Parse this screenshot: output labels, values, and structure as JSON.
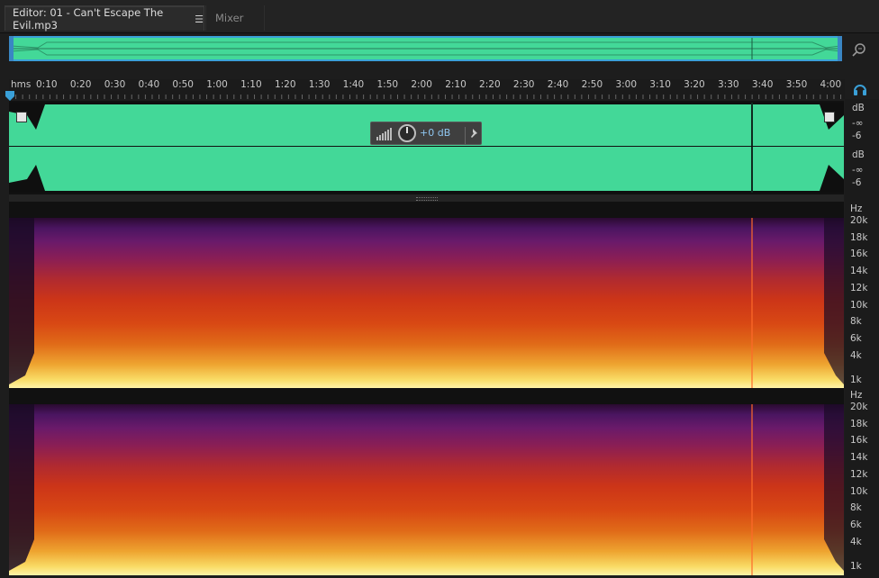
{
  "tabs": {
    "editor_label": "Editor: 01 - Can't Escape The Evil.mp3",
    "mixer_label": "Mixer"
  },
  "ruler": {
    "unit": "hms",
    "ticks": [
      "0:10",
      "0:20",
      "0:30",
      "0:40",
      "0:50",
      "1:00",
      "1:10",
      "1:20",
      "1:30",
      "1:40",
      "1:50",
      "2:00",
      "2:10",
      "2:20",
      "2:30",
      "2:40",
      "2:50",
      "3:00",
      "3:10",
      "3:20",
      "3:30",
      "3:40",
      "3:50",
      "4:00"
    ]
  },
  "hud": {
    "volume": "+0 dB"
  },
  "waveform_scale": {
    "channels": [
      {
        "unit": "dB",
        "labels": [
          "-∞",
          "-6"
        ]
      },
      {
        "unit": "dB",
        "labels": [
          "-∞",
          "-6"
        ]
      }
    ]
  },
  "spectral_scale": {
    "channels": [
      {
        "unit": "Hz",
        "labels": [
          "20k",
          "18k",
          "16k",
          "14k",
          "12k",
          "10k",
          "8k",
          "6k",
          "4k",
          "1k"
        ]
      },
      {
        "unit": "Hz",
        "labels": [
          "20k",
          "18k",
          "16k",
          "14k",
          "12k",
          "10k",
          "8k",
          "6k",
          "4k",
          "1k"
        ]
      }
    ]
  },
  "colors": {
    "waveform": "#43d898",
    "selection_border": "#3aa0d8",
    "hud_value": "#8fc6f0"
  },
  "icons": {
    "zoom": "zoom-icon",
    "menu": "menu-icon",
    "headphone": "headphone-icon",
    "pin": "pin-icon",
    "knob": "volume-knob-icon",
    "meter": "level-meter-icon"
  }
}
